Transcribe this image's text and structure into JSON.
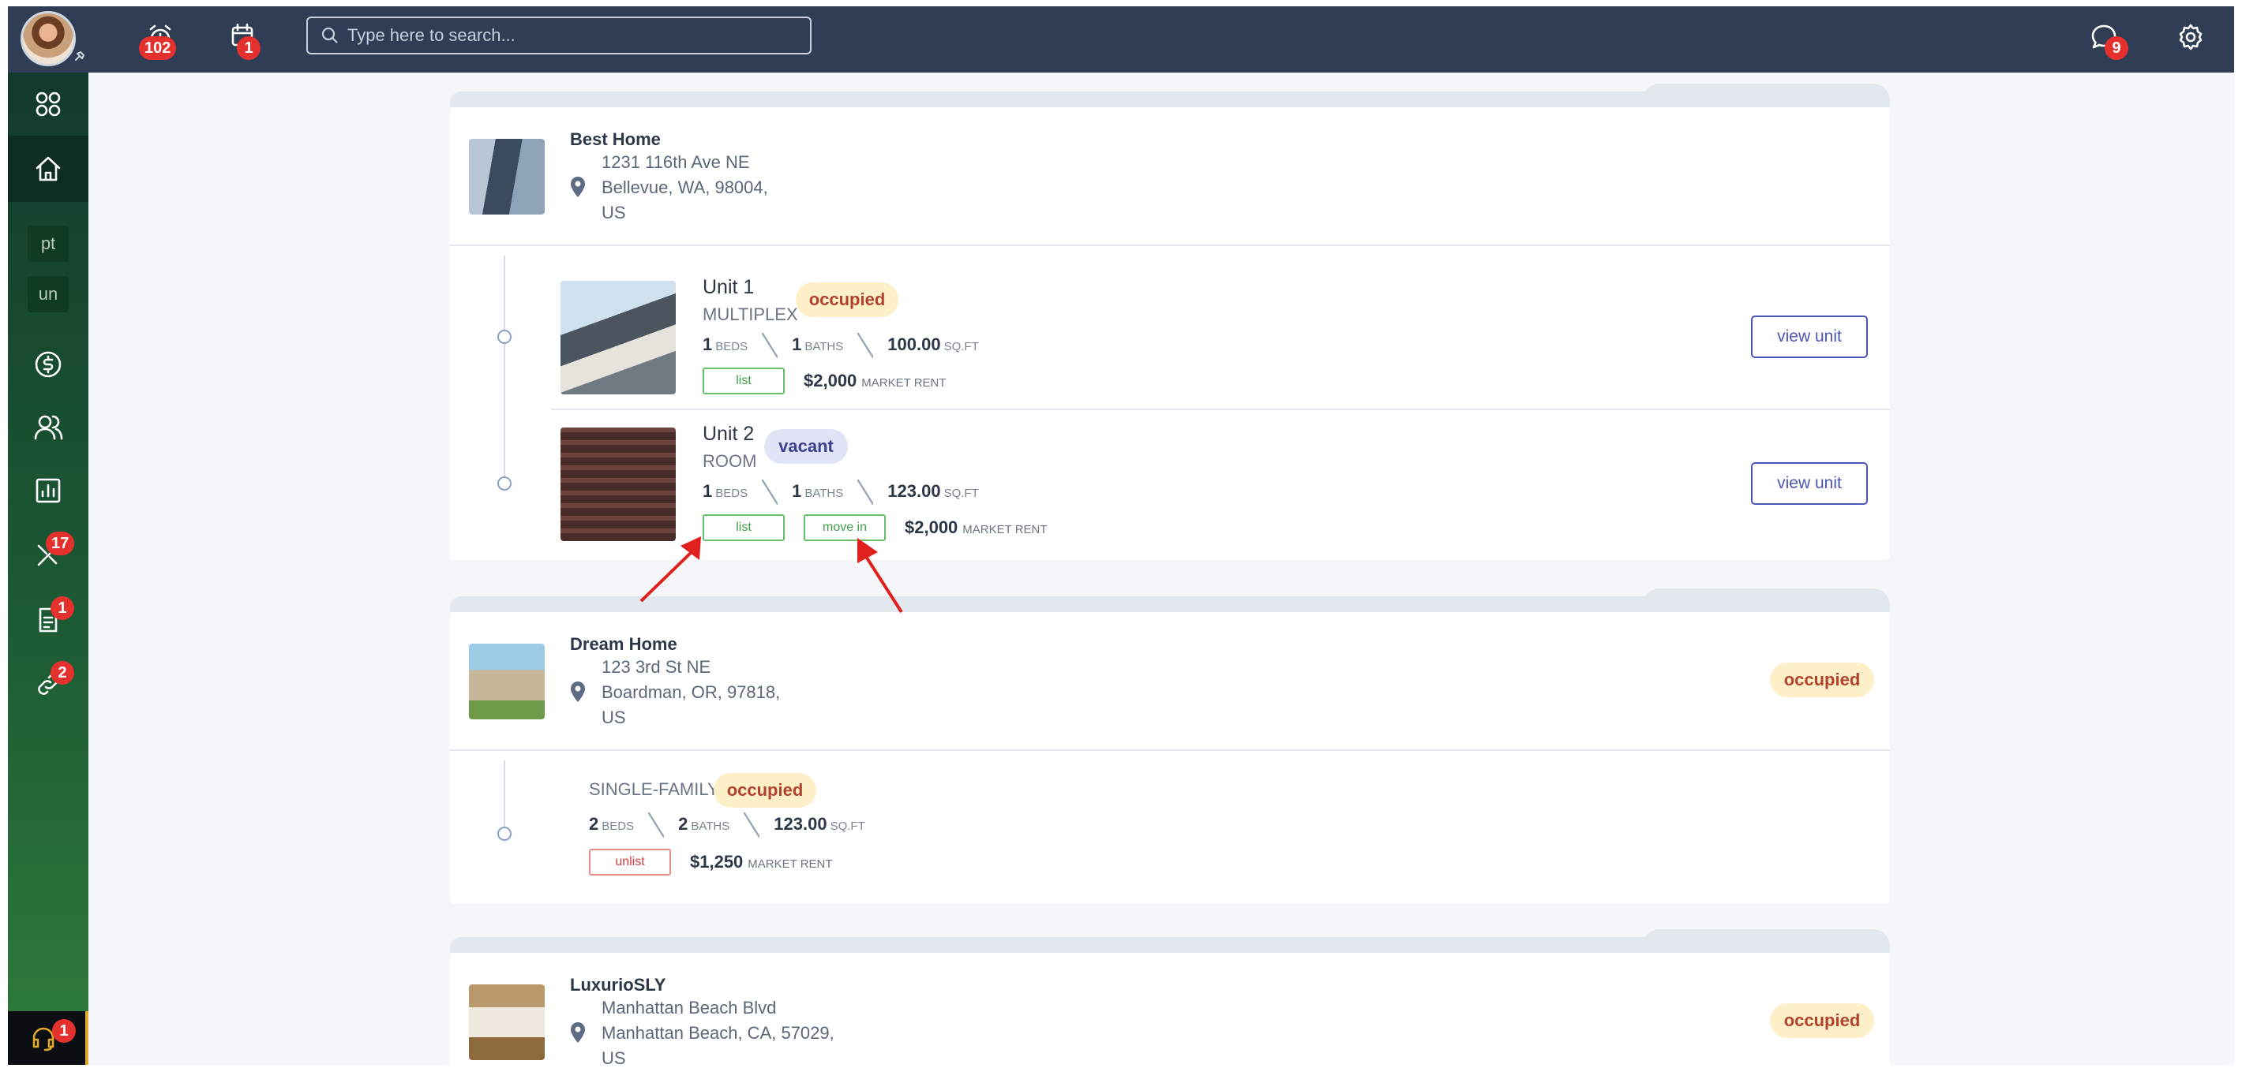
{
  "topbar": {
    "alarm_badge": "102",
    "calendar_badge": "1",
    "search_placeholder": "Type here to search...",
    "chat_badge": "9"
  },
  "sidebar": {
    "items": [
      {
        "name": "dashboard",
        "icon": "grid-icon"
      },
      {
        "name": "home",
        "icon": "home-icon",
        "active": true
      },
      {
        "name": "pt",
        "label": "pt"
      },
      {
        "name": "un",
        "label": "un"
      },
      {
        "name": "payments",
        "icon": "dollar-icon"
      },
      {
        "name": "people",
        "icon": "users-icon"
      },
      {
        "name": "reports",
        "icon": "chart-icon"
      },
      {
        "name": "maintenance",
        "icon": "tools-icon",
        "badge": "17"
      },
      {
        "name": "documents",
        "icon": "document-icon",
        "badge": "1"
      },
      {
        "name": "integrations",
        "icon": "link-icon",
        "badge": "2"
      }
    ],
    "support_badge": "1"
  },
  "properties": [
    {
      "name": "Best Home",
      "address_line1": "1231 116th Ave NE",
      "address_line2": "Bellevue, WA, 98004,",
      "address_line3": "US",
      "units": [
        {
          "name": "Unit 1",
          "type": "MULTIPLEX",
          "status": "occupied",
          "beds": "1",
          "beds_label": "BEDS",
          "baths": "1",
          "baths_label": "BATHS",
          "sqft": "100.00",
          "sqft_label": "SQ.FT",
          "list_label": "list",
          "rent": "$2,000",
          "rent_label": "MARKET RENT",
          "view_label": "view unit"
        },
        {
          "name": "Unit 2",
          "type": "ROOM",
          "status": "vacant",
          "beds": "1",
          "beds_label": "BEDS",
          "baths": "1",
          "baths_label": "BATHS",
          "sqft": "123.00",
          "sqft_label": "SQ.FT",
          "list_label": "list",
          "move_in_label": "move in",
          "rent": "$2,000",
          "rent_label": "MARKET RENT",
          "view_label": "view unit"
        }
      ]
    },
    {
      "name": "Dream Home",
      "address_line1": "123 3rd St NE",
      "address_line2": "Boardman, OR, 97818,",
      "address_line3": "US",
      "status": "occupied",
      "unit": {
        "type": "SINGLE-FAMILY",
        "status": "occupied",
        "beds": "2",
        "beds_label": "BEDS",
        "baths": "2",
        "baths_label": "BATHS",
        "sqft": "123.00",
        "sqft_label": "SQ.FT",
        "unlist_label": "unlist",
        "rent": "$1,250",
        "rent_label": "MARKET RENT"
      }
    },
    {
      "name": "LuxurioSLY",
      "address_line1": "Manhattan Beach Blvd",
      "address_line2": "Manhattan Beach, CA, 57029,",
      "address_line3": "US",
      "status": "occupied"
    }
  ],
  "colors": {
    "topbar": "#2f3e54",
    "sidebar": "#1c5a34",
    "badge": "#e5312d",
    "accent": "#4b55b8",
    "annotation_arrow": "#e0201c"
  }
}
